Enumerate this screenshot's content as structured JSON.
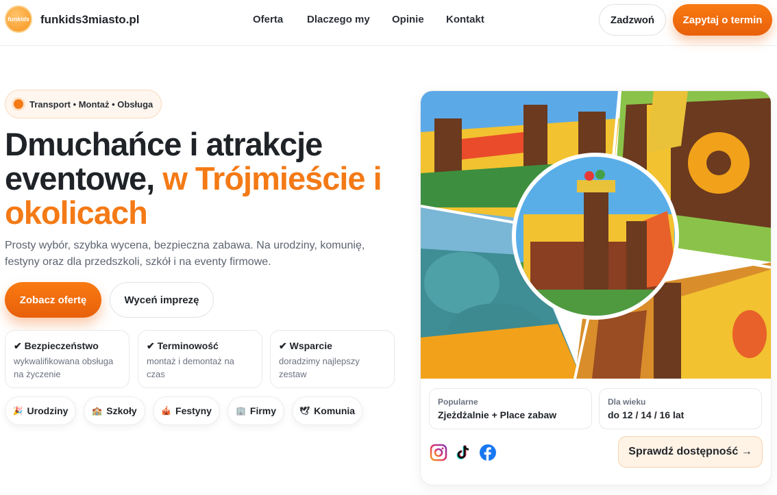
{
  "header": {
    "logo_text": "funkids",
    "brand": "funkids3miasto.pl",
    "nav": [
      "Oferta",
      "Dlaczego my",
      "Opinie",
      "Kontakt"
    ],
    "call_label": "Zadzwoń",
    "ask_label": "Zapytaj o termin"
  },
  "hero": {
    "pill": "Transport • Montaż • Obsługa",
    "title_main": "Dmuchańce i atrakcje eventowe,",
    "title_accent": "w Trójmieście i okolicach",
    "lead": "Prosty wybór, szybka wycena, bezpieczna zabawa. Na urodziny, komunię, festyny oraz dla przedszkoli, szkół i na eventy firmowe.",
    "offer_label": "Zobacz ofertę",
    "price_label": "Wyceń imprezę",
    "features": [
      {
        "title": "✔ Bezpieczeństwo",
        "desc": "wykwalifikowana obsługa na życzenie"
      },
      {
        "title": "✔ Terminowość",
        "desc": "montaż i demontaż na czas"
      },
      {
        "title": "✔ Wsparcie",
        "desc": "doradzimy najlepszy zestaw"
      }
    ],
    "tags": [
      {
        "icon": "🎉",
        "label": "Urodziny"
      },
      {
        "icon": "🏫",
        "label": "Szkoły"
      },
      {
        "icon": "🎪",
        "label": "Festyny"
      },
      {
        "icon": "🏢",
        "label": "Firmy"
      },
      {
        "icon": "🕊",
        "label": "Komunia"
      }
    ]
  },
  "card": {
    "popular_label": "Popularne",
    "popular_value": "Zjeżdżalnie + Place zabaw",
    "age_label": "Dla wieku",
    "age_value": "do 12 / 14 / 16 lat",
    "social_icons": [
      "instagram-icon",
      "tiktok-icon",
      "facebook-icon"
    ],
    "check_label": "Sprawdź dostępność →"
  },
  "colors": {
    "accent": "#f47a16",
    "accent_dark": "#e8600a",
    "text": "#1f2328",
    "muted": "#6b7280"
  }
}
